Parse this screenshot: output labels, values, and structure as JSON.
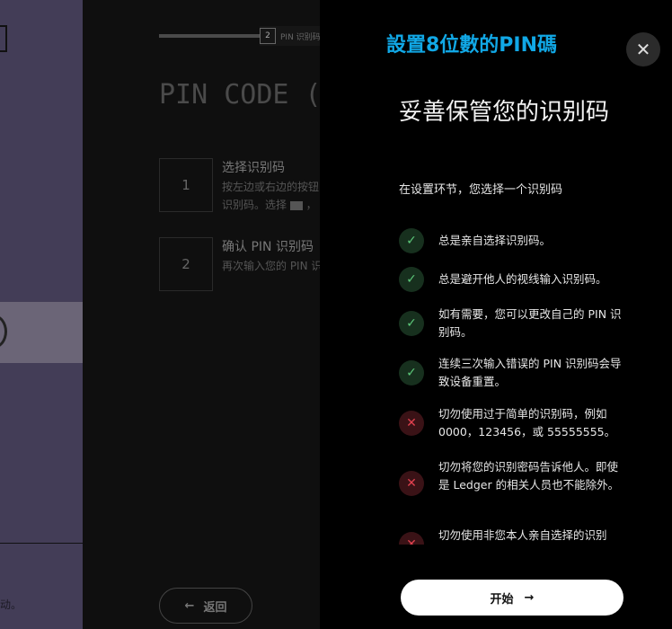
{
  "left_panel": {
    "fragment_text": "动。"
  },
  "background": {
    "step_chip": {
      "number": "2",
      "label": "PIN 识别码"
    },
    "title": "PIN CODE (",
    "steps": [
      {
        "number": "1",
        "title": "选择识别码",
        "desc_line1": "按左边或右边的按钮",
        "desc_line2": "识别码。选择",
        "desc_icon": "backspace-icon",
        "desc_tail": "，"
      },
      {
        "number": "2",
        "title": "确认 PIN 识别码",
        "desc_line1": "再次输入您的 PIN 识"
      }
    ],
    "back_button": {
      "label": "返回",
      "icon": "arrow-left-icon"
    }
  },
  "drawer": {
    "overlay_caption": "設置8位數的PIN碼",
    "close_icon": "close-icon",
    "title": "妥善保管您的识别码",
    "subtitle": "在设置环节，您选择一个识别码",
    "rules": [
      {
        "type": "ok",
        "icon": "check-icon",
        "text": "总是亲自选择识别码。"
      },
      {
        "type": "ok",
        "icon": "check-icon",
        "text": "总是避开他人的视线输入识别码。"
      },
      {
        "type": "ok",
        "icon": "check-icon",
        "text": "如有需要，您可以更改自己的 PIN 识别码。"
      },
      {
        "type": "ok",
        "icon": "check-icon",
        "text": "连续三次输入错误的 PIN 识别码会导致设备重置。"
      },
      {
        "type": "bad",
        "icon": "cross-icon",
        "text": "切勿使用过于简单的识别码，例如 0000，123456，或 55555555。"
      },
      {
        "type": "bad",
        "icon": "cross-icon",
        "text": "切勿将您的识别密码告诉他人。即使是 Ledger 的相关人员也不能除外。"
      },
      {
        "type": "bad",
        "icon": "cross-icon",
        "text": "切勿使用非您本人亲自选择的识别码。"
      }
    ],
    "start_button": {
      "label": "开始",
      "icon": "arrow-right-icon"
    },
    "colors": {
      "caption": "#11a8e6",
      "ok": "#5cc779",
      "bad": "#e0414f"
    }
  }
}
